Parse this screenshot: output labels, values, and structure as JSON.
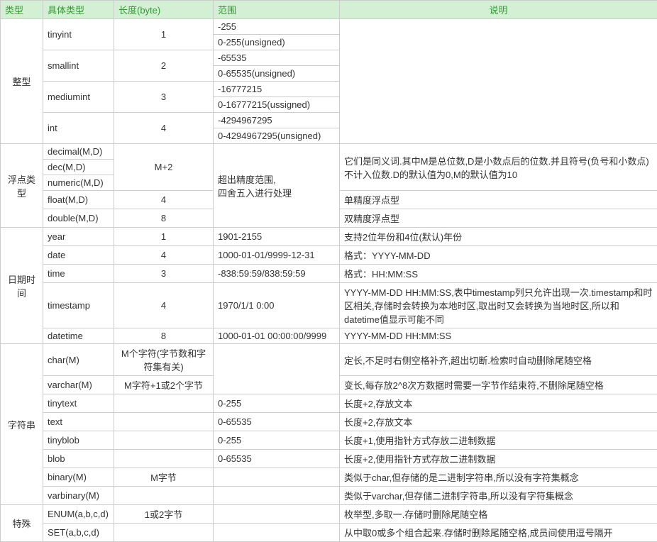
{
  "headers": {
    "type": "类型",
    "subtype": "具体类型",
    "length": "长度(byte)",
    "range": "范围",
    "desc": "说明"
  },
  "groups": {
    "integer": "整型",
    "float": "浮点类型",
    "datetime": "日期时间",
    "string": "字符串",
    "special": "特殊"
  },
  "int": {
    "tinyint": {
      "name": "tinyint",
      "len": "1",
      "r1": "-255",
      "r2": "0-255(unsigned)"
    },
    "smallint": {
      "name": "smallint",
      "len": "2",
      "r1": "-65535",
      "r2": "0-65535(unsigned)"
    },
    "mediumint": {
      "name": "mediumint",
      "len": "3",
      "r1": "-16777215",
      "r2": "0-16777215(ussigned)"
    },
    "intv": {
      "name": "int",
      "len": "4",
      "r1": "-4294967295",
      "r2": "0-4294967295(unsigned)"
    }
  },
  "float": {
    "decimal": "decimal(M,D)",
    "dec": "dec(M,D)",
    "numeric": "numeric(M,D)",
    "len1": "M+2",
    "range1": "超出精度范围,\n四舍五入进行处理",
    "desc1": "它们是同义词.其中M是总位数,D是小数点后的位数.并且符号(负号和小数点)不计入位数.D的默认值为0,M的默认值为10",
    "floatv": {
      "name": "float(M,D)",
      "len": "4",
      "desc": "单精度浮点型"
    },
    "doublev": {
      "name": "double(M,D)",
      "len": "8",
      "desc": "双精度浮点型"
    }
  },
  "dt": {
    "year": {
      "name": "year",
      "len": "1",
      "range": "1901-2155",
      "desc": "支持2位年份和4位(默认)年份"
    },
    "date": {
      "name": "date",
      "len": "4",
      "range": "1000-01-01/9999-12-31",
      "desc": "格式：YYYY-MM-DD"
    },
    "time": {
      "name": "time",
      "len": "3",
      "range": "-838:59:59/838:59:59",
      "desc": "格式：HH:MM:SS"
    },
    "timestamp": {
      "name": "timestamp",
      "len": "4",
      "range": "1970/1/1 0:00",
      "desc": "YYYY-MM-DD HH:MM:SS,表中timestamp列只允许出现一次.timestamp和时区相关,存储时会转换为本地时区,取出时又会转换为当地时区,所以和datetime值显示可能不同"
    },
    "datetime": {
      "name": "datetime",
      "len": "8",
      "range": "1000-01-01 00:00:00/9999",
      "desc": "YYYY-MM-DD HH:MM:SS"
    }
  },
  "str": {
    "charv": {
      "name": "char(M)",
      "len": "M个字符(字节数和字符集有关)",
      "desc": "定长,不足时右侧空格补齐,超出切断.检索时自动删除尾随空格"
    },
    "varchar": {
      "name": "varchar(M)",
      "len": "M字符+1或2个字节",
      "desc": "变长,每存放2^8次方数据时需要一字节作结束符,不删除尾随空格"
    },
    "tinytext": {
      "name": "tinytext",
      "range": "0-255",
      "desc": "长度+2,存放文本"
    },
    "text": {
      "name": "text",
      "range": "0-65535",
      "desc": "长度+2,存放文本"
    },
    "tinyblob": {
      "name": "tinyblob",
      "range": "0-255",
      "desc": "长度+1,使用指针方式存放二进制数据"
    },
    "blob": {
      "name": "blob",
      "range": "0-65535",
      "desc": "长度+2,使用指针方式存放二进制数据"
    },
    "binary": {
      "name": "binary(M)",
      "len": "M字节",
      "desc": "类似于char,但存储的是二进制字符串,所以没有字符集概念"
    },
    "varbinary": {
      "name": "varbinary(M)",
      "desc": "类似于varchar,但存储二进制字符串,所以没有字符集概念"
    }
  },
  "sp": {
    "enum": {
      "name": "ENUM(a,b,c,d)",
      "len": "1或2字节",
      "desc": "枚举型,多取一.存储时删除尾随空格"
    },
    "set": {
      "name": "SET(a,b,c,d)",
      "desc": "从中取0或多个组合起来.存储时删除尾随空格,成员间使用逗号隔开"
    }
  }
}
